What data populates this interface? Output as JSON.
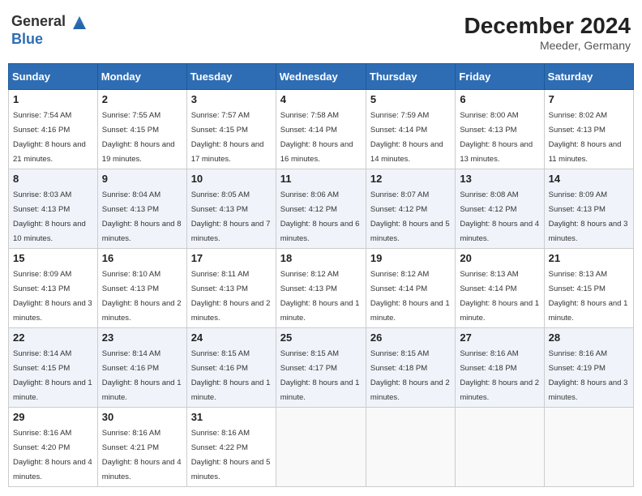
{
  "header": {
    "logo_general": "General",
    "logo_blue": "Blue",
    "month": "December 2024",
    "location": "Meeder, Germany"
  },
  "weekdays": [
    "Sunday",
    "Monday",
    "Tuesday",
    "Wednesday",
    "Thursday",
    "Friday",
    "Saturday"
  ],
  "weeks": [
    [
      {
        "day": "1",
        "sunrise": "7:54 AM",
        "sunset": "4:16 PM",
        "daylight": "8 hours and 21 minutes."
      },
      {
        "day": "2",
        "sunrise": "7:55 AM",
        "sunset": "4:15 PM",
        "daylight": "8 hours and 19 minutes."
      },
      {
        "day": "3",
        "sunrise": "7:57 AM",
        "sunset": "4:15 PM",
        "daylight": "8 hours and 17 minutes."
      },
      {
        "day": "4",
        "sunrise": "7:58 AM",
        "sunset": "4:14 PM",
        "daylight": "8 hours and 16 minutes."
      },
      {
        "day": "5",
        "sunrise": "7:59 AM",
        "sunset": "4:14 PM",
        "daylight": "8 hours and 14 minutes."
      },
      {
        "day": "6",
        "sunrise": "8:00 AM",
        "sunset": "4:13 PM",
        "daylight": "8 hours and 13 minutes."
      },
      {
        "day": "7",
        "sunrise": "8:02 AM",
        "sunset": "4:13 PM",
        "daylight": "8 hours and 11 minutes."
      }
    ],
    [
      {
        "day": "8",
        "sunrise": "8:03 AM",
        "sunset": "4:13 PM",
        "daylight": "8 hours and 10 minutes."
      },
      {
        "day": "9",
        "sunrise": "8:04 AM",
        "sunset": "4:13 PM",
        "daylight": "8 hours and 8 minutes."
      },
      {
        "day": "10",
        "sunrise": "8:05 AM",
        "sunset": "4:13 PM",
        "daylight": "8 hours and 7 minutes."
      },
      {
        "day": "11",
        "sunrise": "8:06 AM",
        "sunset": "4:12 PM",
        "daylight": "8 hours and 6 minutes."
      },
      {
        "day": "12",
        "sunrise": "8:07 AM",
        "sunset": "4:12 PM",
        "daylight": "8 hours and 5 minutes."
      },
      {
        "day": "13",
        "sunrise": "8:08 AM",
        "sunset": "4:12 PM",
        "daylight": "8 hours and 4 minutes."
      },
      {
        "day": "14",
        "sunrise": "8:09 AM",
        "sunset": "4:13 PM",
        "daylight": "8 hours and 3 minutes."
      }
    ],
    [
      {
        "day": "15",
        "sunrise": "8:09 AM",
        "sunset": "4:13 PM",
        "daylight": "8 hours and 3 minutes."
      },
      {
        "day": "16",
        "sunrise": "8:10 AM",
        "sunset": "4:13 PM",
        "daylight": "8 hours and 2 minutes."
      },
      {
        "day": "17",
        "sunrise": "8:11 AM",
        "sunset": "4:13 PM",
        "daylight": "8 hours and 2 minutes."
      },
      {
        "day": "18",
        "sunrise": "8:12 AM",
        "sunset": "4:13 PM",
        "daylight": "8 hours and 1 minute."
      },
      {
        "day": "19",
        "sunrise": "8:12 AM",
        "sunset": "4:14 PM",
        "daylight": "8 hours and 1 minute."
      },
      {
        "day": "20",
        "sunrise": "8:13 AM",
        "sunset": "4:14 PM",
        "daylight": "8 hours and 1 minute."
      },
      {
        "day": "21",
        "sunrise": "8:13 AM",
        "sunset": "4:15 PM",
        "daylight": "8 hours and 1 minute."
      }
    ],
    [
      {
        "day": "22",
        "sunrise": "8:14 AM",
        "sunset": "4:15 PM",
        "daylight": "8 hours and 1 minute."
      },
      {
        "day": "23",
        "sunrise": "8:14 AM",
        "sunset": "4:16 PM",
        "daylight": "8 hours and 1 minute."
      },
      {
        "day": "24",
        "sunrise": "8:15 AM",
        "sunset": "4:16 PM",
        "daylight": "8 hours and 1 minute."
      },
      {
        "day": "25",
        "sunrise": "8:15 AM",
        "sunset": "4:17 PM",
        "daylight": "8 hours and 1 minute."
      },
      {
        "day": "26",
        "sunrise": "8:15 AM",
        "sunset": "4:18 PM",
        "daylight": "8 hours and 2 minutes."
      },
      {
        "day": "27",
        "sunrise": "8:16 AM",
        "sunset": "4:18 PM",
        "daylight": "8 hours and 2 minutes."
      },
      {
        "day": "28",
        "sunrise": "8:16 AM",
        "sunset": "4:19 PM",
        "daylight": "8 hours and 3 minutes."
      }
    ],
    [
      {
        "day": "29",
        "sunrise": "8:16 AM",
        "sunset": "4:20 PM",
        "daylight": "8 hours and 4 minutes."
      },
      {
        "day": "30",
        "sunrise": "8:16 AM",
        "sunset": "4:21 PM",
        "daylight": "8 hours and 4 minutes."
      },
      {
        "day": "31",
        "sunrise": "8:16 AM",
        "sunset": "4:22 PM",
        "daylight": "8 hours and 5 minutes."
      },
      null,
      null,
      null,
      null
    ]
  ],
  "labels": {
    "sunrise": "Sunrise:",
    "sunset": "Sunset:",
    "daylight": "Daylight:"
  }
}
